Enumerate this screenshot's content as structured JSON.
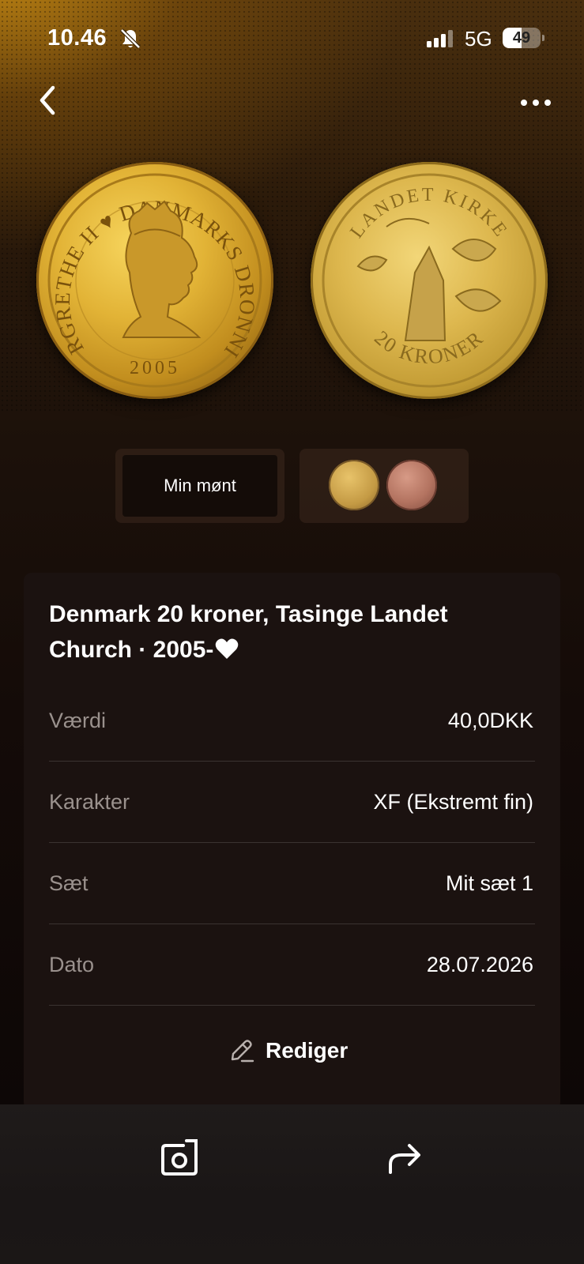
{
  "status_bar": {
    "time": "10.46",
    "network": "5G",
    "battery": "49",
    "battery_level": 0.49,
    "icons": [
      "bell-muted-icon",
      "signal-icon",
      "battery-icon"
    ]
  },
  "nav": {
    "back_icon": "chevron-left-icon",
    "more_icon": "ellipsis-icon"
  },
  "coin_obverse": {
    "legend": "MARGRETHE II ♥ DANMARKS DRONNING",
    "year": "2005"
  },
  "coin_reverse": {
    "legend": "LANDET KIRKE",
    "denomination": "20 KRONER"
  },
  "image_tabs": {
    "my_coin_label": "Min mønt"
  },
  "details": {
    "title": "Denmark 20 kroner, Tasinge Landet Church · 2005-",
    "title_icon": "heart-icon",
    "rows": [
      {
        "label": "Værdi",
        "value": "40,0DKK"
      },
      {
        "label": "Karakter",
        "value": "XF (Ekstremt fin)"
      },
      {
        "label": "Sæt",
        "value": "Mit sæt 1"
      },
      {
        "label": "Dato",
        "value": "28.07.2026"
      }
    ],
    "edit_label": "Rediger",
    "edit_icon": "pencil-icon"
  },
  "bottom_bar": {
    "icons": [
      "camera-icon",
      "share-icon"
    ]
  },
  "colors": {
    "accent_gold": "#d9a92a",
    "card_bg": "#1b1210",
    "label_gray": "#9a918d"
  }
}
